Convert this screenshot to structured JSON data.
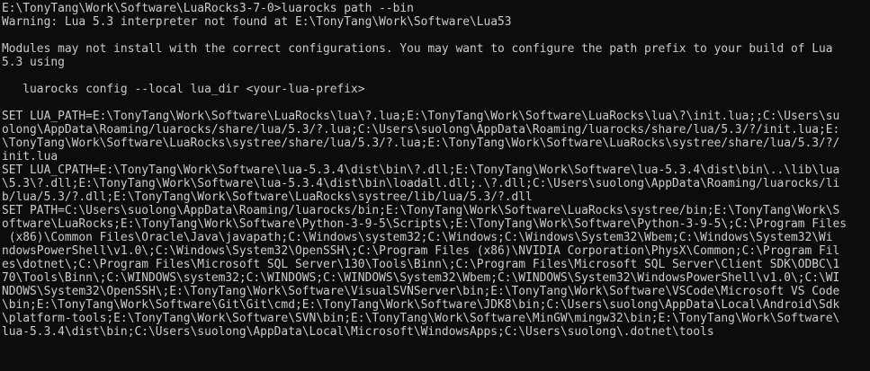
{
  "console": {
    "background": "#0c0c0c",
    "foreground": "#cccccc",
    "lines": [
      "E:\\TonyTang\\Work\\Software\\LuaRocks3-7-0>luarocks path --bin",
      "Warning: Lua 5.3 interpreter not found at E:\\TonyTang\\Work\\Software\\Lua53",
      "",
      "Modules may not install with the correct configurations. You may want to configure the path prefix to your build of Lua",
      "5.3 using",
      "",
      "   luarocks config --local lua_dir <your-lua-prefix>",
      "",
      "SET LUA_PATH=E:\\TonyTang\\Work\\Software\\LuaRocks\\lua\\?.lua;E:\\TonyTang\\Work\\Software\\LuaRocks\\lua\\?\\init.lua;;C:\\Users\\su",
      "olong\\AppData\\Roaming/luarocks/share/lua/5.3/?.lua;C:\\Users\\suolong\\AppData\\Roaming/luarocks/share/lua/5.3/?/init.lua;E:",
      "\\TonyTang\\Work\\Software\\LuaRocks\\systree/share/lua/5.3/?.lua;E:\\TonyTang\\Work\\Software\\LuaRocks\\systree/share/lua/5.3/?/",
      "init.lua",
      "SET LUA_CPATH=E:\\TonyTang\\Work\\Software\\lua-5.3.4\\dist\\bin\\?.dll;E:\\TonyTang\\Work\\Software\\lua-5.3.4\\dist\\bin\\..\\lib\\lua",
      "\\5.3\\?.dll;E:\\TonyTang\\Work\\Software\\lua-5.3.4\\dist\\bin\\loadall.dll;.\\?.dll;C:\\Users\\suolong\\AppData\\Roaming/luarocks/li",
      "b/lua/5.3/?.dll;E:\\TonyTang\\Work\\Software\\LuaRocks\\systree/lib/lua/5.3/?.dll",
      "SET PATH=C:\\Users\\suolong\\AppData\\Roaming/luarocks/bin;E:\\TonyTang\\Work\\Software\\LuaRocks\\systree/bin;E:\\TonyTang\\Work\\S",
      "oftware\\LuaRocks;E:\\TonyTang\\Work\\Software\\Python-3-9-5\\Scripts\\;E:\\TonyTang\\Work\\Software\\Python-3-9-5\\;C:\\Program Files",
      " (x86)\\Common Files\\Oracle\\Java\\javapath;C:\\Windows\\system32;C:\\Windows;C:\\Windows\\System32\\Wbem;C:\\Windows\\System32\\Wi",
      "ndowsPowerShell\\v1.0\\;C:\\Windows\\System32\\OpenSSH\\;C:\\Program Files (x86)\\NVIDIA Corporation\\PhysX\\Common;C:\\Program Fil",
      "es\\dotnet\\;C:\\Program Files\\Microsoft SQL Server\\130\\Tools\\Binn\\;C:\\Program Files\\Microsoft SQL Server\\Client SDK\\ODBC\\1",
      "70\\Tools\\Binn\\;C:\\WINDOWS\\system32;C:\\WINDOWS;C:\\WINDOWS\\System32\\Wbem;C:\\WINDOWS\\System32\\WindowsPowerShell\\v1.0\\;C:\\WI",
      "NDOWS\\System32\\OpenSSH\\;E:\\TonyTang\\Work\\Software\\VisualSVNServer\\bin;E:\\TonyTang\\Work\\Software\\VSCode\\Microsoft VS Code",
      "\\bin;E:\\TonyTang\\Work\\Software\\Git\\Git\\cmd;E:\\TonyTang\\Work\\Software\\JDK8\\bin;C:\\Users\\suolong\\AppData\\Local\\Android\\Sdk",
      "\\platform-tools;E:\\TonyTang\\Work\\Software\\SVN\\bin;E:\\TonyTang\\Work\\Software\\MinGW\\mingw32\\bin;E:\\TonyTang\\Work\\Software\\",
      "lua-5.3.4\\dist\\bin;C:\\Users\\suolong\\AppData\\Local\\Microsoft\\WindowsApps;C:\\Users\\suolong\\.dotnet\\tools"
    ]
  }
}
